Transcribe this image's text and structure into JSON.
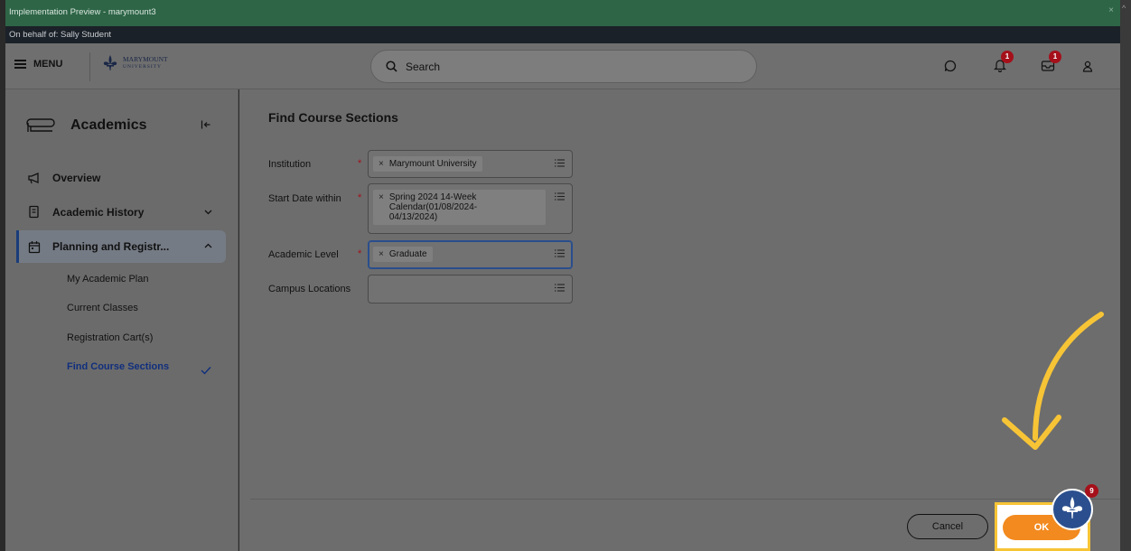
{
  "window": {
    "title": "Implementation Preview - marymount3",
    "close": "×"
  },
  "behalf": "On behalf of: Sally Student",
  "header": {
    "menu_label": "MENU",
    "logo_line1": "MARYMOUNT",
    "logo_line2": "UNIVERSITY",
    "search_placeholder": "Search",
    "notifications_badge": "1",
    "inbox_badge": "1"
  },
  "sidebar": {
    "title": "Academics",
    "items": [
      {
        "label": "Overview"
      },
      {
        "label": "Academic History"
      },
      {
        "label": "Planning and Registr..."
      }
    ],
    "subitems": [
      {
        "label": "My Academic Plan"
      },
      {
        "label": "Current Classes"
      },
      {
        "label": "Registration Cart(s)"
      },
      {
        "label": "Find Course Sections"
      }
    ]
  },
  "main": {
    "title": "Find Course Sections",
    "fields": [
      {
        "label": "Institution",
        "value": "Marymount University",
        "required": true
      },
      {
        "label": "Start Date within",
        "value_line1": "Spring 2024 14-Week",
        "value_line2": "Calendar(01/08/2024-",
        "value_line3": "04/13/2024)",
        "required": true
      },
      {
        "label": "Academic Level",
        "value": "Graduate",
        "required": true
      },
      {
        "label": "Campus Locations",
        "value": "",
        "required": false
      }
    ],
    "cancel_label": "Cancel",
    "ok_label": "OK",
    "helper_badge": "9"
  },
  "colors": {
    "accent": "#f7c436",
    "ok": "#f28a1f",
    "topbar": "#2e6547",
    "badge": "#a5101a"
  }
}
